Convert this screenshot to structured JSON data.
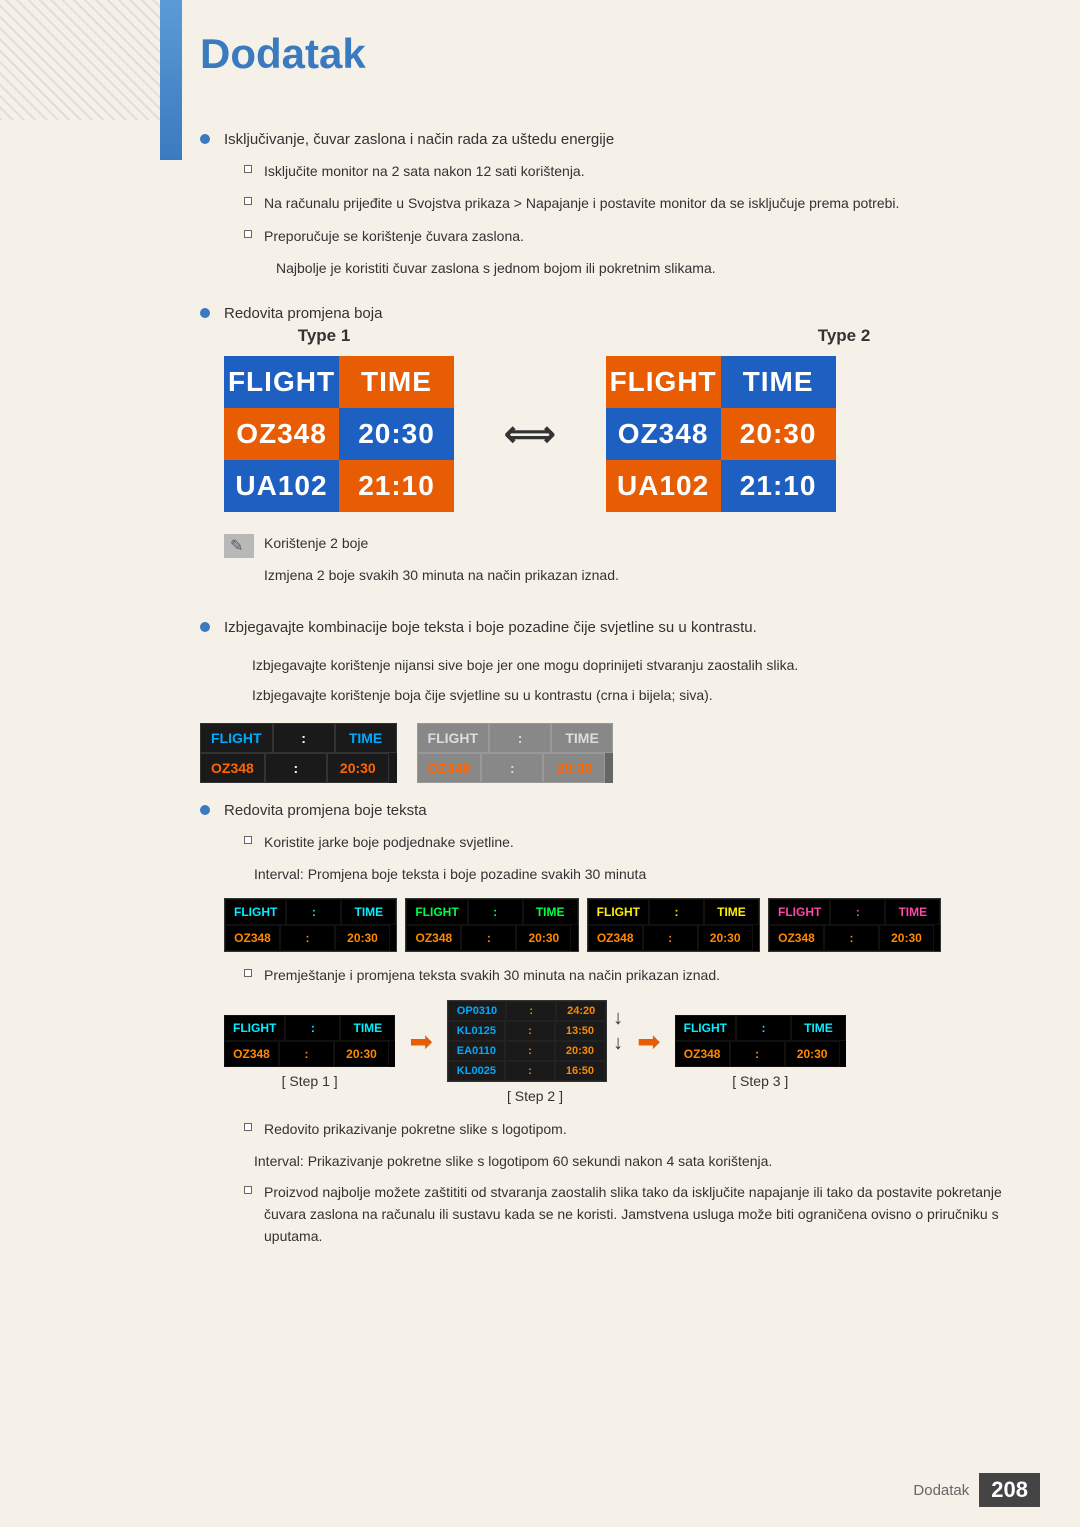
{
  "page": {
    "title": "Dodatak",
    "footer_label": "Dodatak",
    "footer_page": "208"
  },
  "type_labels": {
    "type1": "Type 1",
    "type2": "Type 2"
  },
  "flight_boards": {
    "header_left": "FLIGHT",
    "header_right": "TIME",
    "row1_left": "OZ348",
    "row1_right": "20:30",
    "row2_left": "UA102",
    "row2_right": "21:10"
  },
  "step_labels": {
    "step1": "[ Step 1 ]",
    "step2": "[ Step 2 ]",
    "step3": "[ Step 3 ]"
  },
  "content": {
    "bullet1": "Isključivanje, čuvar zaslona i način rada za uštedu energije",
    "sub1a": "Isključite monitor na 2 sata nakon 12 sati korištenja.",
    "sub1b": "Na računalu prijeđite u Svojstva prikaza > Napajanje i postavite monitor da se isključuje prema potrebi.",
    "sub1c": "Preporučuje se korištenje čuvara zaslona.",
    "sub1c_indent": "Najbolje je koristiti čuvar zaslona s jednom bojom ili pokretnim slikama.",
    "bullet2": "Redovita promjena boja",
    "note1": "Korištenje 2 boje",
    "note1_indent": "Izmjena 2 boje svakih 30 minuta na način prikazan iznad.",
    "bullet3": "Izbjegavajte kombinacije boje teksta i boje pozadine čije svjetline su u kontrastu.",
    "indent3a": "Izbjegavajte korištenje nijansi sive boje jer one mogu doprinijeti stvaranju zaostalih slika.",
    "indent3b": "Izbjegavajte korištenje boja čije svjetline su u kontrastu (crna i bijela; siva).",
    "bullet4": "Redovita promjena boje teksta",
    "sub4a": "Koristite jarke boje podjednake svjetline.",
    "sub4a_indent": "Interval: Promjena boje teksta i boje pozadine svakih 30 minuta",
    "sub4b": "Premještanje i promjena teksta svakih 30 minuta na način prikazan iznad.",
    "sub4c": "Redovito prikazivanje pokretne slike s logotipom.",
    "sub4c_indent": "Interval: Prikazivanje pokretne slike s logotipom 60 sekundi nakon 4 sata korištenja.",
    "sub4d": "Proizvod najbolje možete zaštititi od stvaranja zaostalih slika tako da isključite napajanje ili tako da postavite pokretanje čuvara zaslona na računalu ili sustavu kada se ne koristi. Jamstvena usluga može biti ograničena ovisno o priručniku s uputama."
  }
}
